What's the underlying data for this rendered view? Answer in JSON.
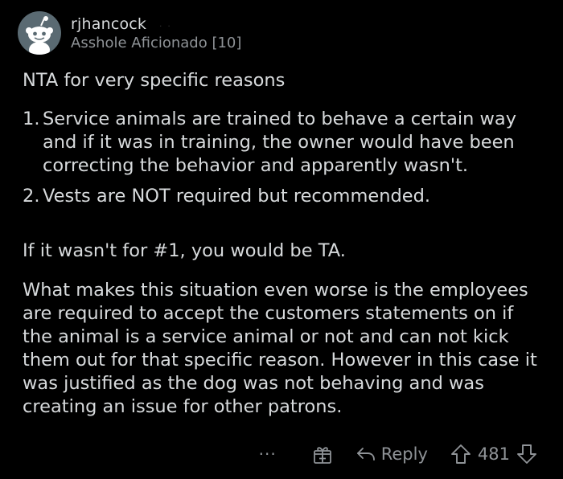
{
  "comment": {
    "author": "rjhancock",
    "header_dots": "· ·",
    "flair": "Asshole Aficionado [10]",
    "paragraph_1": "NTA for very specific reasons",
    "list_items": [
      {
        "number": "1.",
        "text": "Service animals are trained to behave a certain way and if it was in training, the owner would have been correcting the behavior and apparently wasn't."
      },
      {
        "number": "2.",
        "text": "Vests are NOT required but recommended."
      }
    ],
    "paragraph_2": "If it wasn't for #1, you would be TA.",
    "paragraph_3": "What makes this situation even worse is the employees are required to accept the customers statements on if the animal is a service animal or not and can not kick them out for that specific reason. However in this case it was justified as the dog was not behaving and was creating an issue for other patrons."
  },
  "actions": {
    "more": "···",
    "reply_label": "Reply",
    "score": "481"
  },
  "icons": {
    "avatar": "snoo-avatar-icon",
    "more": "more-options-icon",
    "gift": "gift-award-icon",
    "reply": "reply-arrow-icon",
    "upvote": "upvote-arrow-icon",
    "downvote": "downvote-arrow-icon"
  },
  "colors": {
    "background": "#000000",
    "text": "#d7dadc",
    "muted": "#8f9397",
    "avatar_bg": "#5a6a72"
  }
}
